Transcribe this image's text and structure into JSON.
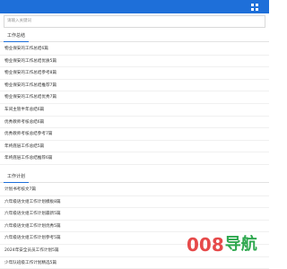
{
  "search": {
    "placeholder": "请输入关键词"
  },
  "sections": [
    {
      "title": "工作总结",
      "items": [
        "物业保安的工作总结6篇",
        "物业保安的工作总结优质5篇",
        "物业保安的工作总结参考8篇",
        "物业保安的工作总结推荐7篇",
        "物业保安的工作总结优秀7篇",
        "车间主管半年总结6篇",
        "优秀教师考核总结6篇",
        "优秀教师考核总结参考7篇",
        "年终底层工作总结5篇",
        "年终底层工作总结推荐6篇"
      ]
    },
    {
      "title": "工作计划",
      "items": [
        "计划书考核文7篇",
        "六年级语文组工作计划模板8篇",
        "六年级语文组工作计划最新5篇",
        "六年级语文组工作计划优秀5篇",
        "六年级语文组工作计划参考5篇",
        "2024年安全员员工作计划5篇",
        "少年队班级工作计划精选5篇"
      ]
    }
  ],
  "watermark": {
    "number": "008",
    "text": "导航"
  },
  "colors": {
    "topbar": "#1e6fd9",
    "accent": "#1e6fd9",
    "watermark_number": "#e64a4a",
    "watermark_text": "#2fa84f"
  },
  "icons": {
    "menu": "grid-menu-icon"
  }
}
